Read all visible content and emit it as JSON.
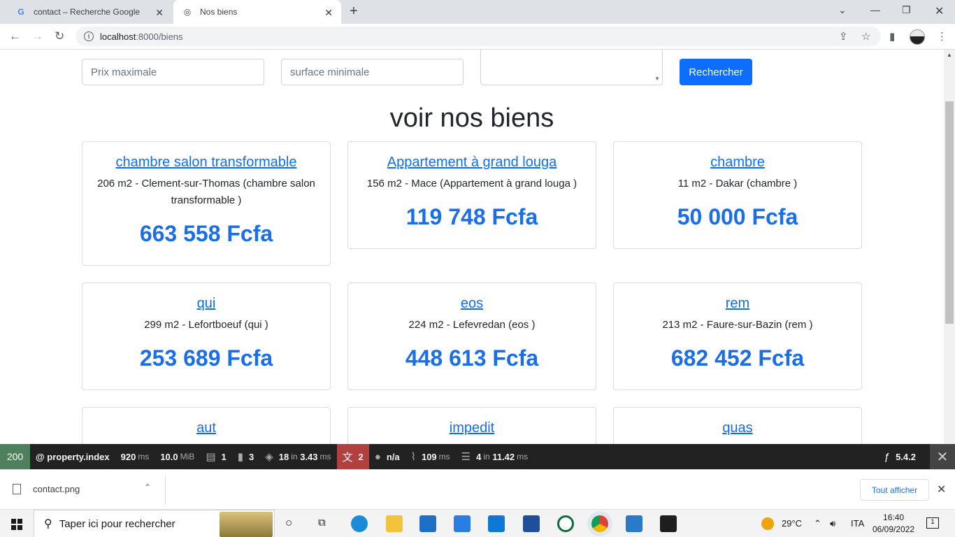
{
  "browser": {
    "tabs": [
      {
        "title": "contact – Recherche Google",
        "icon": "google-icon"
      },
      {
        "title": "Nos biens",
        "icon": "globe-icon"
      }
    ],
    "url_host": "localhost",
    "url_path": ":8000/biens"
  },
  "search": {
    "price_placeholder": "Prix maximale",
    "surface_placeholder": "surface minimale",
    "button_label": "Rechercher"
  },
  "page_title": "voir nos biens",
  "properties": [
    {
      "title": "chambre salon transformable",
      "description": "206 m2 - Clement-sur-Thomas (chambre salon transformable )",
      "price": "663 558 Fcfa"
    },
    {
      "title": "Appartement à grand louga",
      "description": "156 m2 - Mace (Appartement à grand louga )",
      "price": "119 748 Fcfa"
    },
    {
      "title": "chambre",
      "description": "11 m2 - Dakar (chambre )",
      "price": "50 000 Fcfa"
    },
    {
      "title": "qui",
      "description": "299 m2 - Lefortboeuf (qui )",
      "price": "253 689 Fcfa"
    },
    {
      "title": "eos",
      "description": "224 m2 - Lefevredan (eos )",
      "price": "448 613 Fcfa"
    },
    {
      "title": "rem",
      "description": "213 m2 - Faure-sur-Bazin (rem )",
      "price": "682 452 Fcfa"
    },
    {
      "title": "aut"
    },
    {
      "title": "impedit"
    },
    {
      "title": "quas"
    }
  ],
  "debug_toolbar": {
    "status": "200",
    "route": "@ property.index",
    "time": "920",
    "time_unit": "ms",
    "memory": "10.0",
    "memory_unit": "MiB",
    "forms": "1",
    "validator": "3",
    "cache": "18",
    "cache_in": "in",
    "cache_time": "3.43",
    "cache_unit": "ms",
    "translations": "2",
    "user": "n/a",
    "twig_time": "109",
    "twig_unit": "ms",
    "db_queries": "4",
    "db_in": "in",
    "db_time": "11.42",
    "db_unit": "ms",
    "symfony_version": "5.4.2"
  },
  "download_bar": {
    "file": "contact.png",
    "show_all": "Tout afficher"
  },
  "taskbar": {
    "search_placeholder": "Taper ici pour rechercher",
    "temperature": "29°C",
    "language": "ITA",
    "time": "16:40",
    "date": "06/09/2022",
    "notifications": "1"
  }
}
